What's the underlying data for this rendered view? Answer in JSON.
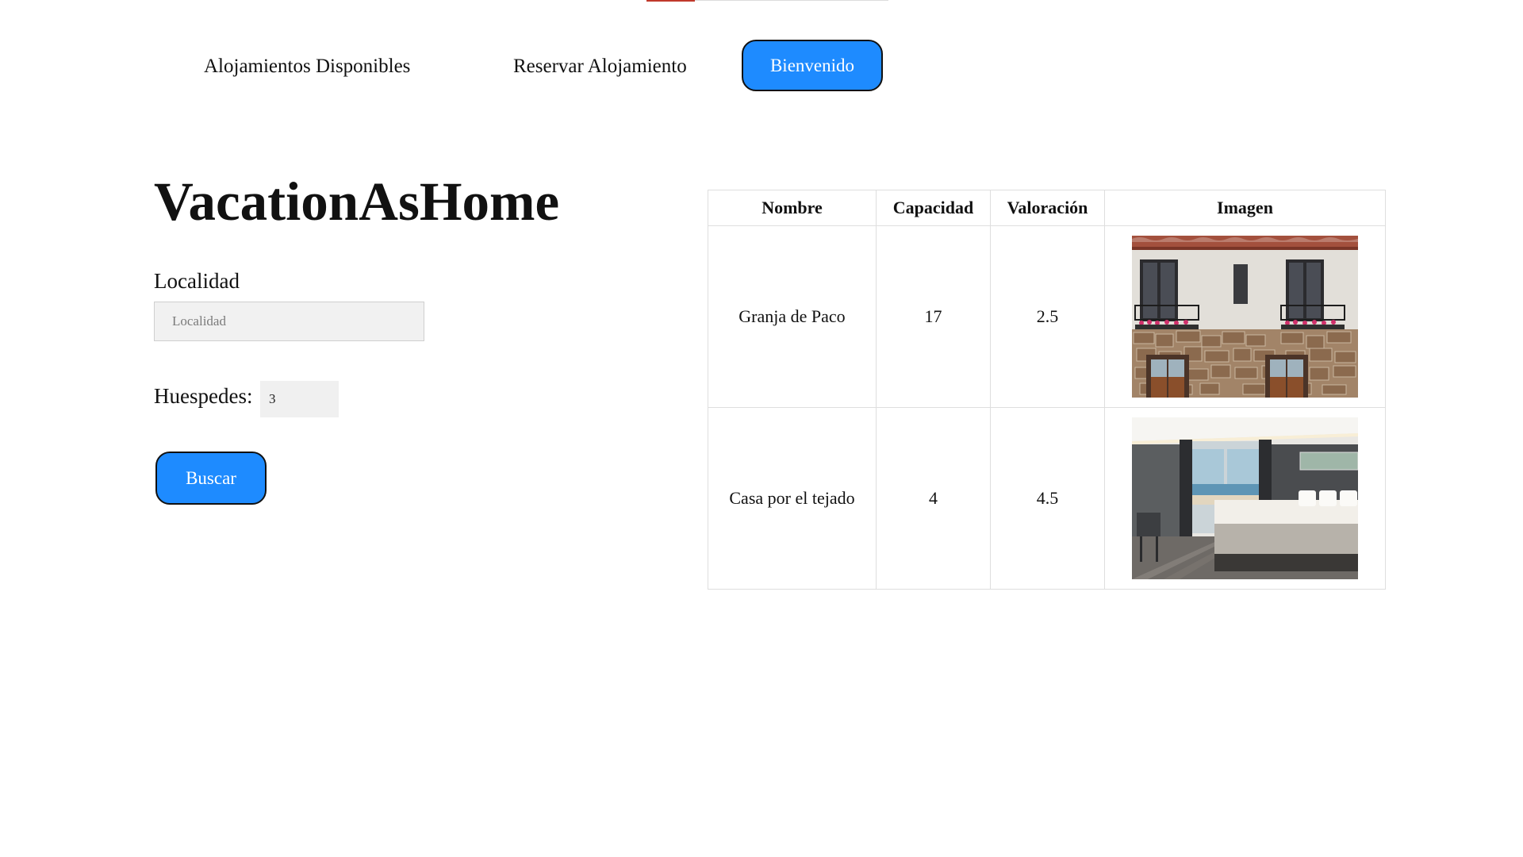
{
  "nav": {
    "links": [
      "Alojamientos Disponibles",
      "Reservar Alojamiento"
    ],
    "welcome_button": "Bienvenido"
  },
  "brand": {
    "title": "VacationAsHome"
  },
  "search": {
    "location_label": "Localidad",
    "location_value": "",
    "location_placeholder": "Localidad",
    "guests_label": "Huespedes:",
    "guests_value": "3",
    "submit_label": "Buscar"
  },
  "results": {
    "headers": [
      "Nombre",
      "Capacidad",
      "Valoración",
      "Imagen"
    ],
    "rows": [
      {
        "nombre": "Granja de Paco",
        "capacidad": "17",
        "valoracion": "2.5",
        "image_desc": "stone-townhouse-with-balconies-photo"
      },
      {
        "nombre": "Casa por el tejado",
        "capacidad": "4",
        "valoracion": "4.5",
        "image_desc": "hotel-bedroom-with-sea-view-photo"
      }
    ]
  },
  "colors": {
    "accent": "#1e8bff",
    "top_strip_accent": "#c0392b"
  }
}
